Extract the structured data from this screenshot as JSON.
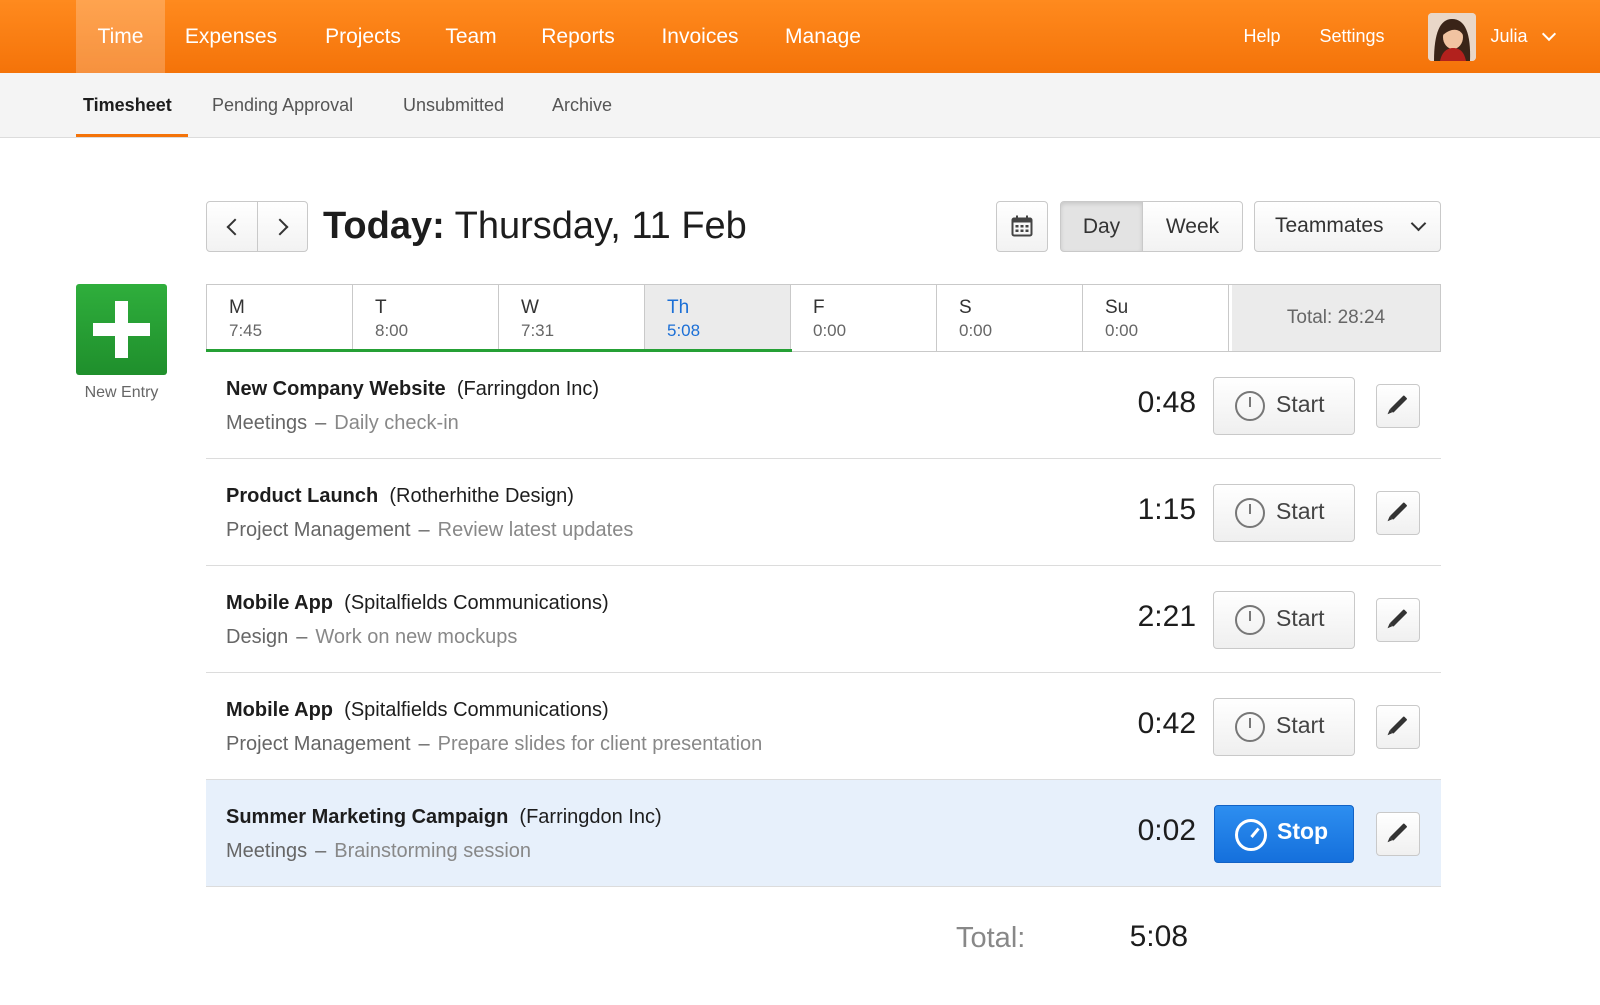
{
  "nav": {
    "items": [
      "Time",
      "Expenses",
      "Projects",
      "Team",
      "Reports",
      "Invoices",
      "Manage"
    ],
    "active": "Time",
    "help": "Help",
    "settings": "Settings",
    "user": "Julia"
  },
  "subnav": {
    "items": [
      "Timesheet",
      "Pending Approval",
      "Unsubmitted",
      "Archive"
    ],
    "active": "Timesheet"
  },
  "header": {
    "title_prefix": "Today:",
    "title_date": "Thursday, 11 Feb",
    "views": [
      "Day",
      "Week"
    ],
    "active_view": "Day",
    "teammates": "Teammates"
  },
  "new_entry": {
    "label": "New Entry"
  },
  "week": {
    "days": [
      {
        "name": "M",
        "value": "7:45"
      },
      {
        "name": "T",
        "value": "8:00"
      },
      {
        "name": "W",
        "value": "7:31"
      },
      {
        "name": "Th",
        "value": "5:08"
      },
      {
        "name": "F",
        "value": "0:00"
      },
      {
        "name": "S",
        "value": "0:00"
      },
      {
        "name": "Su",
        "value": "0:00"
      }
    ],
    "active_day": "Th",
    "total": "Total: 28:24"
  },
  "entries": [
    {
      "project": "New Company Website",
      "client": "(Farringdon Inc)",
      "task": "Meetings",
      "notes": "Daily check-in",
      "duration": "0:48",
      "action": "Start"
    },
    {
      "project": "Product Launch",
      "client": "(Rotherhithe Design)",
      "task": "Project Management",
      "notes": "Review latest updates",
      "duration": "1:15",
      "action": "Start"
    },
    {
      "project": "Mobile App",
      "client": "(Spitalfields Communications)",
      "task": "Design",
      "notes": "Work on new mockups",
      "duration": "2:21",
      "action": "Start"
    },
    {
      "project": "Mobile App",
      "client": "(Spitalfields Communications)",
      "task": "Project Management",
      "notes": "Prepare slides for client presentation",
      "duration": "0:42",
      "action": "Start"
    },
    {
      "project": "Summer Marketing Campaign",
      "client": "(Farringdon Inc)",
      "task": "Meetings",
      "notes": "Brainstorming session",
      "duration": "0:02",
      "action": "Stop"
    }
  ],
  "separator": "–",
  "totals": {
    "label": "Total:",
    "value": "5:08"
  },
  "colors": {
    "brand": "#f47309",
    "new_entry": "#25a035",
    "running": "#1570dc"
  }
}
